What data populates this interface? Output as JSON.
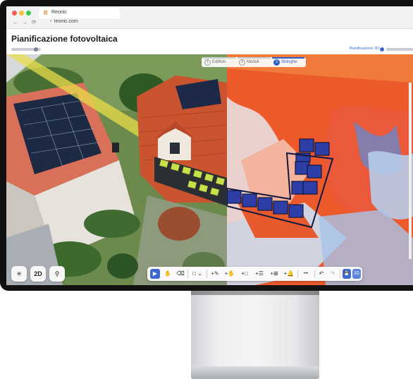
{
  "browser": {
    "tab_logo": "R",
    "tab_title": "Reonic",
    "back": "←",
    "forward": "→",
    "reload": "⟳",
    "lock": "🔒",
    "url": "reonic.com"
  },
  "header": {
    "title": "Pianificazione fotovoltaica",
    "planning_3d_label": "Pianificazione 3D"
  },
  "steps": [
    {
      "num": "1",
      "label": "Edificio",
      "active": false
    },
    {
      "num": "2",
      "label": "Moduli",
      "active": false
    },
    {
      "num": "3",
      "label": "Stringhe",
      "active": true
    }
  ],
  "view_controls": {
    "view_2d": "2D",
    "compass_icon": "compass-icon",
    "pin_icon": "map-pin-icon"
  },
  "toolbar": {
    "select": "▶",
    "hand": "✋",
    "eraser": "⌫",
    "shape": "□ ⌄",
    "add_line": "+✎",
    "add_hand": "+✋",
    "add_rect": "+□",
    "add_list": "+☰",
    "add_grid": "+⊞",
    "add_bell": "+🔔",
    "more": "•••",
    "undo": "↶",
    "redo": "↷",
    "save": "💾",
    "view_3d": "3D"
  },
  "colors": {
    "accent": "#2e5fc9",
    "heatmap": "#ec5a2c",
    "panel_green": "#c7e14a",
    "panel_blue": "#3a55c8"
  }
}
